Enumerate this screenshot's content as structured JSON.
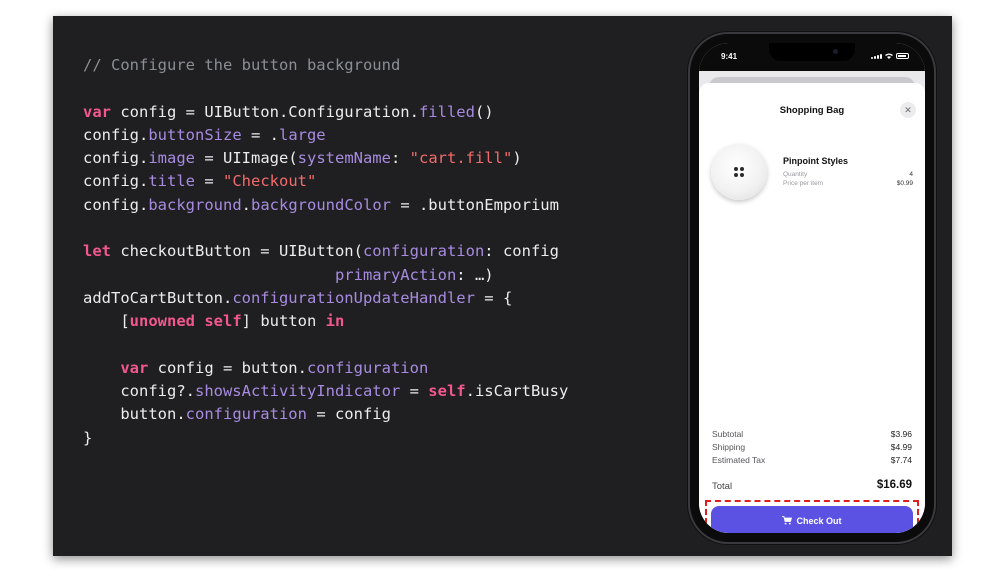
{
  "code": {
    "lines": [
      [
        {
          "t": "comment",
          "s": "// Configure the button background"
        }
      ],
      [],
      [
        {
          "t": "keyword",
          "s": "var"
        },
        {
          "t": "plain",
          "s": " config = UIButton.Configuration."
        },
        {
          "t": "property",
          "s": "filled"
        },
        {
          "t": "plain",
          "s": "()"
        }
      ],
      [
        {
          "t": "plain",
          "s": "config."
        },
        {
          "t": "property",
          "s": "buttonSize"
        },
        {
          "t": "plain",
          "s": " = ."
        },
        {
          "t": "property",
          "s": "large"
        }
      ],
      [
        {
          "t": "plain",
          "s": "config."
        },
        {
          "t": "property",
          "s": "image"
        },
        {
          "t": "plain",
          "s": " = UIImage("
        },
        {
          "t": "property",
          "s": "systemName"
        },
        {
          "t": "plain",
          "s": ": "
        },
        {
          "t": "string",
          "s": "\"cart.fill\""
        },
        {
          "t": "plain",
          "s": ")"
        }
      ],
      [
        {
          "t": "plain",
          "s": "config."
        },
        {
          "t": "property",
          "s": "title"
        },
        {
          "t": "plain",
          "s": " = "
        },
        {
          "t": "string",
          "s": "\"Checkout\""
        }
      ],
      [
        {
          "t": "plain",
          "s": "config."
        },
        {
          "t": "property",
          "s": "background"
        },
        {
          "t": "plain",
          "s": "."
        },
        {
          "t": "property",
          "s": "backgroundColor"
        },
        {
          "t": "plain",
          "s": " = .buttonEmporium"
        }
      ],
      [],
      [
        {
          "t": "keyword",
          "s": "let"
        },
        {
          "t": "plain",
          "s": " checkoutButton = UIButton("
        },
        {
          "t": "property",
          "s": "configuration"
        },
        {
          "t": "plain",
          "s": ": config"
        }
      ],
      [
        {
          "t": "plain",
          "s": "                           "
        },
        {
          "t": "property",
          "s": "primaryAction"
        },
        {
          "t": "plain",
          "s": ": …)"
        }
      ],
      [
        {
          "t": "plain",
          "s": "addToCartButton."
        },
        {
          "t": "property",
          "s": "configurationUpdateHandler"
        },
        {
          "t": "plain",
          "s": " = {"
        }
      ],
      [
        {
          "t": "plain",
          "s": "    ["
        },
        {
          "t": "keyword",
          "s": "unowned"
        },
        {
          "t": "plain",
          "s": " "
        },
        {
          "t": "keyword",
          "s": "self"
        },
        {
          "t": "plain",
          "s": "] button "
        },
        {
          "t": "keyword",
          "s": "in"
        }
      ],
      [],
      [
        {
          "t": "plain",
          "s": "    "
        },
        {
          "t": "keyword",
          "s": "var"
        },
        {
          "t": "plain",
          "s": " config = button."
        },
        {
          "t": "property",
          "s": "configuration"
        }
      ],
      [
        {
          "t": "plain",
          "s": "    config?."
        },
        {
          "t": "property",
          "s": "showsActivityIndicator"
        },
        {
          "t": "plain",
          "s": " = "
        },
        {
          "t": "keyword",
          "s": "self"
        },
        {
          "t": "plain",
          "s": ".isCartBusy"
        }
      ],
      [
        {
          "t": "plain",
          "s": "    button."
        },
        {
          "t": "property",
          "s": "configuration"
        },
        {
          "t": "plain",
          "s": " = config"
        }
      ],
      [
        {
          "t": "plain",
          "s": "}"
        }
      ]
    ]
  },
  "phone": {
    "status_time": "9:41",
    "sheet_title": "Shopping Bag",
    "close_glyph": "✕",
    "product": {
      "name": "Pinpoint Styles",
      "quantity_label": "Quantity",
      "quantity_value": "4",
      "price_label": "Price per item",
      "price_value": "$0.99"
    },
    "summary": {
      "subtotal_label": "Subtotal",
      "subtotal_value": "$3.96",
      "shipping_label": "Shipping",
      "shipping_value": "$4.99",
      "tax_label": "Estimated Tax",
      "tax_value": "$7.74",
      "total_label": "Total",
      "total_value": "$16.69"
    },
    "checkout_label": "Check Out",
    "checkout_icon": "cart-icon",
    "button_color": "#5b52e3",
    "highlight_color": "#e01e1e"
  }
}
